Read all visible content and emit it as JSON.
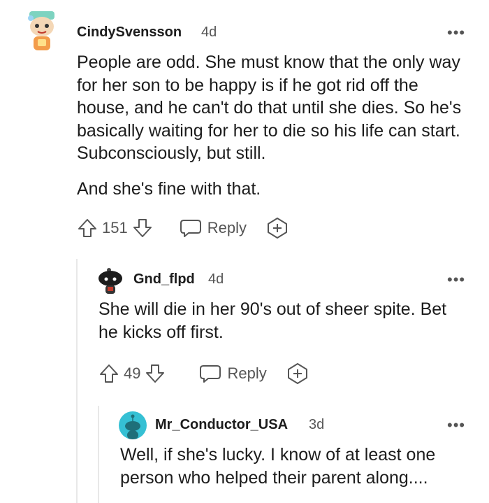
{
  "comments": [
    {
      "username": "CindySvensson",
      "age": "4d",
      "paragraphs": [
        "People are odd. She must know that the only way for her son to be happy is if he got rid off the house, and he can't do that until she dies. So he's basically waiting for her to die so his life can start. Subconsciously, but still.",
        "And she's fine with that."
      ],
      "score": "151",
      "reply_label": "Reply"
    },
    {
      "username": "Gnd_flpd",
      "age": "4d",
      "paragraphs": [
        "She will die in her 90's out of sheer spite. Bet he kicks off first."
      ],
      "score": "49",
      "reply_label": "Reply"
    },
    {
      "username": "Mr_Conductor_USA",
      "age": "3d",
      "paragraphs": [
        "Well, if she's lucky. I know of at least one person who helped their parent along...."
      ]
    }
  ],
  "more_label": "•••",
  "colors": {
    "text": "#1c1c1c",
    "muted": "#555555",
    "avatar_teal": "#35c0d4"
  }
}
